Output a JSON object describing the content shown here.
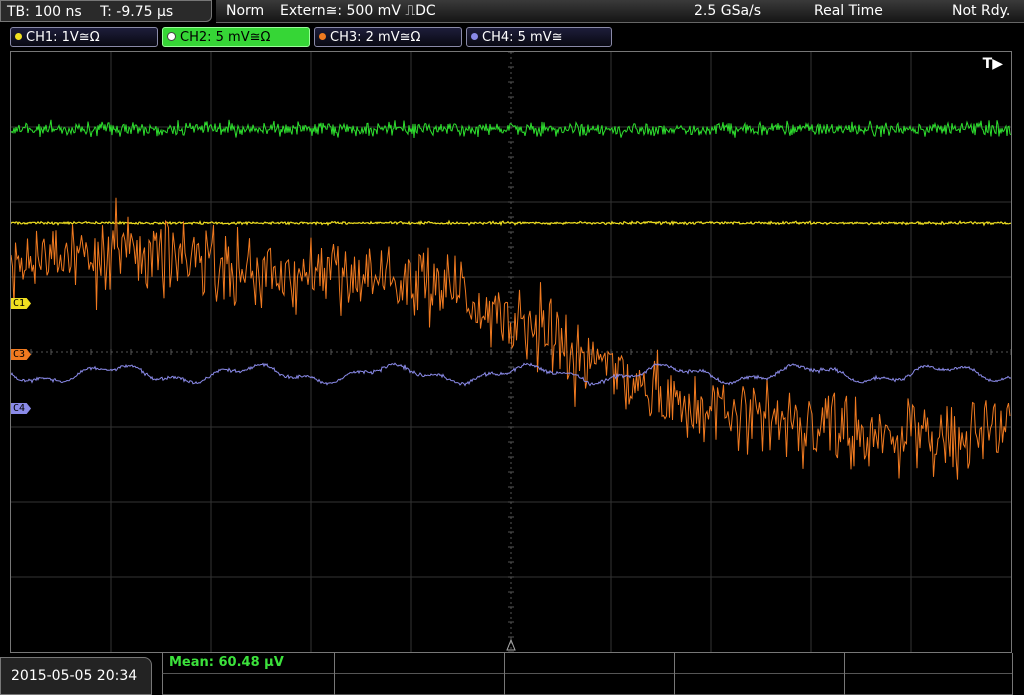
{
  "header": {
    "timebase": "TB: 100 ns",
    "trigger_time": "T: -9.75 µs",
    "mode": "Norm",
    "trigger_source": "Extern≅: 500 mV ⎍DC",
    "sample_rate": "2.5 GSa/s",
    "acq_mode": "Real Time",
    "status": "Not Rdy."
  },
  "channels": [
    {
      "label": "CH1: 1V≅Ω",
      "color": "#f0e020"
    },
    {
      "label": "CH2: 5 mV≅Ω",
      "color": "#2ee02e"
    },
    {
      "label": "CH3: 2 mV≅Ω",
      "color": "#f07a20"
    },
    {
      "label": "CH4: 5 mV≅",
      "color": "#8a8ae8"
    }
  ],
  "markers": {
    "c1": "C1",
    "c3": "C3",
    "c4": "C4",
    "trigger": "T▶"
  },
  "footer": {
    "datetime": "2015-05-05 20:34",
    "measurement": "Mean: 60.48 µV"
  },
  "icons": [
    "channel-dot-icon",
    "trigger-position-icon",
    "trigger-time-icon"
  ]
}
